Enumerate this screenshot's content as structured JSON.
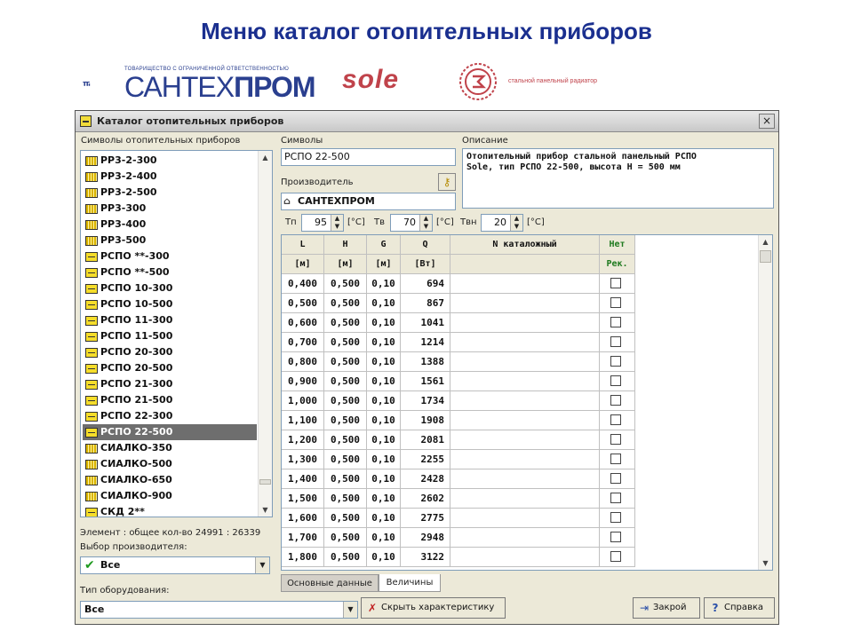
{
  "slide": {
    "title": "Меню каталог отопительных приборов"
  },
  "logos": {
    "santehprom_small": "ТОВАРИЩЕСТВО С ОГРАНИЧЕННОЙ ОТВЕТСТВЕННОСТЬЮ",
    "santehprom_a": "САНТЕХ",
    "santehprom_b": "ПРОМ",
    "sole_word": "sole",
    "sole_tag": "стальной панельный радиатор"
  },
  "window": {
    "title": "Каталог отопительных приборов",
    "close": "×"
  },
  "left": {
    "list_label": "Символы отопительных приборов",
    "items": [
      {
        "label": "РР3-2-300",
        "icon": "radiator-icon"
      },
      {
        "label": "РР3-2-400",
        "icon": "radiator-icon"
      },
      {
        "label": "РР3-2-500",
        "icon": "radiator-icon"
      },
      {
        "label": "РР3-300",
        "icon": "radiator-icon"
      },
      {
        "label": "РР3-400",
        "icon": "radiator-icon"
      },
      {
        "label": "РР3-500",
        "icon": "radiator-icon"
      },
      {
        "label": "РСПО **-300",
        "icon": "panel-icon"
      },
      {
        "label": "РСПО **-500",
        "icon": "panel-icon"
      },
      {
        "label": "РСПО 10-300",
        "icon": "panel-icon"
      },
      {
        "label": "РСПО 10-500",
        "icon": "panel-icon"
      },
      {
        "label": "РСПО 11-300",
        "icon": "panel-icon"
      },
      {
        "label": "РСПО 11-500",
        "icon": "panel-icon"
      },
      {
        "label": "РСПО 20-300",
        "icon": "panel-icon"
      },
      {
        "label": "РСПО 20-500",
        "icon": "panel-icon"
      },
      {
        "label": "РСПО 21-300",
        "icon": "panel-icon"
      },
      {
        "label": "РСПО 21-500",
        "icon": "panel-icon"
      },
      {
        "label": "РСПО 22-300",
        "icon": "panel-icon"
      },
      {
        "label": "РСПО 22-500",
        "icon": "panel-icon",
        "selected": true
      },
      {
        "label": "СИАЛКО-350",
        "icon": "radiator-icon"
      },
      {
        "label": "СИАЛКО-500",
        "icon": "radiator-icon"
      },
      {
        "label": "СИАЛКО-650",
        "icon": "radiator-icon"
      },
      {
        "label": "СИАЛКО-900",
        "icon": "radiator-icon"
      },
      {
        "label": "СКД 2**",
        "icon": "panel-icon"
      }
    ],
    "element_count": "Элемент : общее кол-во 24991 : 26339",
    "manufacturer_label": "Выбор производителя:",
    "manufacturer_value": "Все",
    "equipment_label": "Тип оборудования:",
    "equipment_value": "Все"
  },
  "fields": {
    "symbols_label": "Символы",
    "symbols_value": "РСПО 22-500",
    "manufacturer_label": "Производитель",
    "manufacturer_value": "САНТЕХПРОМ",
    "description_label": "Описание",
    "description_line1": "Отопительный прибор стальной панельный РСПО",
    "description_line2": "Sole, тип РСПО 22-500, высота Н = 500 мм"
  },
  "temps": {
    "tp_label": "Тп",
    "tp_value": "95",
    "tp_unit": "[°C]",
    "tv_label": "Тв",
    "tv_value": "70",
    "tv_unit": "[°C]",
    "tvn_label": "Твн",
    "tvn_value": "20",
    "tvn_unit": "[°C]"
  },
  "table": {
    "headers": [
      "L",
      "H",
      "G",
      "Q",
      "N каталожный",
      "Нет"
    ],
    "units": [
      "[м]",
      "[м]",
      "[м]",
      "[Вт]",
      "",
      "Рек."
    ],
    "rows": [
      [
        "0,400",
        "0,500",
        "0,10",
        "694"
      ],
      [
        "0,500",
        "0,500",
        "0,10",
        "867"
      ],
      [
        "0,600",
        "0,500",
        "0,10",
        "1041"
      ],
      [
        "0,700",
        "0,500",
        "0,10",
        "1214"
      ],
      [
        "0,800",
        "0,500",
        "0,10",
        "1388"
      ],
      [
        "0,900",
        "0,500",
        "0,10",
        "1561"
      ],
      [
        "1,000",
        "0,500",
        "0,10",
        "1734"
      ],
      [
        "1,100",
        "0,500",
        "0,10",
        "1908"
      ],
      [
        "1,200",
        "0,500",
        "0,10",
        "2081"
      ],
      [
        "1,300",
        "0,500",
        "0,10",
        "2255"
      ],
      [
        "1,400",
        "0,500",
        "0,10",
        "2428"
      ],
      [
        "1,500",
        "0,500",
        "0,10",
        "2602"
      ],
      [
        "1,600",
        "0,500",
        "0,10",
        "2775"
      ],
      [
        "1,700",
        "0,500",
        "0,10",
        "2948"
      ],
      [
        "1,800",
        "0,500",
        "0,10",
        "3122"
      ]
    ]
  },
  "tabs": [
    "Основные данные",
    "Величины"
  ],
  "buttons": {
    "hide": "Скрыть характеристику",
    "close": "Закрой",
    "help": "Справка"
  }
}
